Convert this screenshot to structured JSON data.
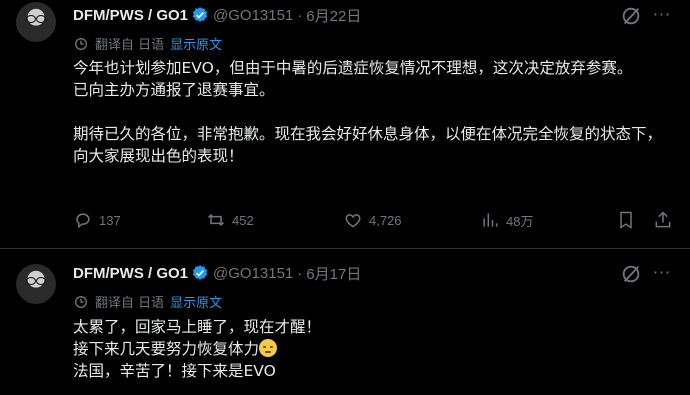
{
  "tweets": [
    {
      "author_name": "DFM/PWS / GO1",
      "handle": "@GO13151",
      "separator": "·",
      "date": "6月22日",
      "translate_meta": "翻译自 日语",
      "translate_link": "显示原文",
      "lines": [
        "今年也计划参加EVO，但由于中暑的后遗症恢复情况不理想，这次决定放弃参赛。",
        "已向主办方通报了退赛事宜。",
        "",
        "期待已久的各位，非常抱歉。现在我会好好休息身体，以便在体况完全恢复的状态下，向大家展现出色的表现！"
      ],
      "replies": "137",
      "reposts": "452",
      "likes": "4,726",
      "views": "48万"
    },
    {
      "author_name": "DFM/PWS / GO1",
      "handle": "@GO13151",
      "separator": "·",
      "date": "6月17日",
      "translate_meta": "翻译自 日语",
      "translate_link": "显示原文",
      "lines": [
        "太累了，回家马上睡了，现在才醒！",
        "接下来几天要努力恢复体力",
        "法国，辛苦了！接下来是EVO"
      ]
    }
  ],
  "colors": {
    "background": "#000000",
    "text": "#e7e9ea",
    "muted": "#71767b",
    "accent": "#1d9bf0",
    "divider": "#2f3336"
  },
  "icons": [
    "verified-badge-icon",
    "grok-icon",
    "more-icon",
    "translate-icon",
    "reply-icon",
    "repost-icon",
    "like-icon",
    "views-icon",
    "bookmark-icon",
    "share-icon",
    "tired-face-emoji"
  ]
}
